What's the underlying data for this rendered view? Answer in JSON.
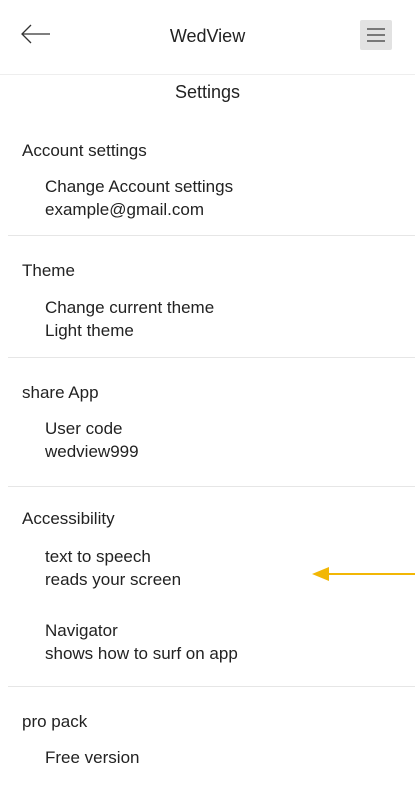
{
  "header": {
    "app_title": "WedView",
    "back_icon": "arrow-left-icon",
    "menu_icon": "hamburger-menu-icon"
  },
  "page_title": "Settings",
  "sections": [
    {
      "title": "Account settings",
      "items": [
        {
          "label": "Change Account settings",
          "value": "example@gmail.com"
        }
      ]
    },
    {
      "title": "Theme",
      "items": [
        {
          "label": "Change current theme",
          "value": "Light theme"
        }
      ]
    },
    {
      "title": "share App",
      "items": [
        {
          "label": "User code",
          "value": "wedview999"
        }
      ]
    },
    {
      "title": "Accessibility",
      "items": [
        {
          "label": "text to speech",
          "value": "reads your screen"
        },
        {
          "label": "Navigator",
          "value": "shows how to surf on app"
        }
      ]
    },
    {
      "title": "pro pack",
      "items": [
        {
          "label": "Free version"
        }
      ]
    }
  ],
  "annotation": {
    "icon": "pointer-arrow-icon",
    "color": "#F2B705"
  }
}
